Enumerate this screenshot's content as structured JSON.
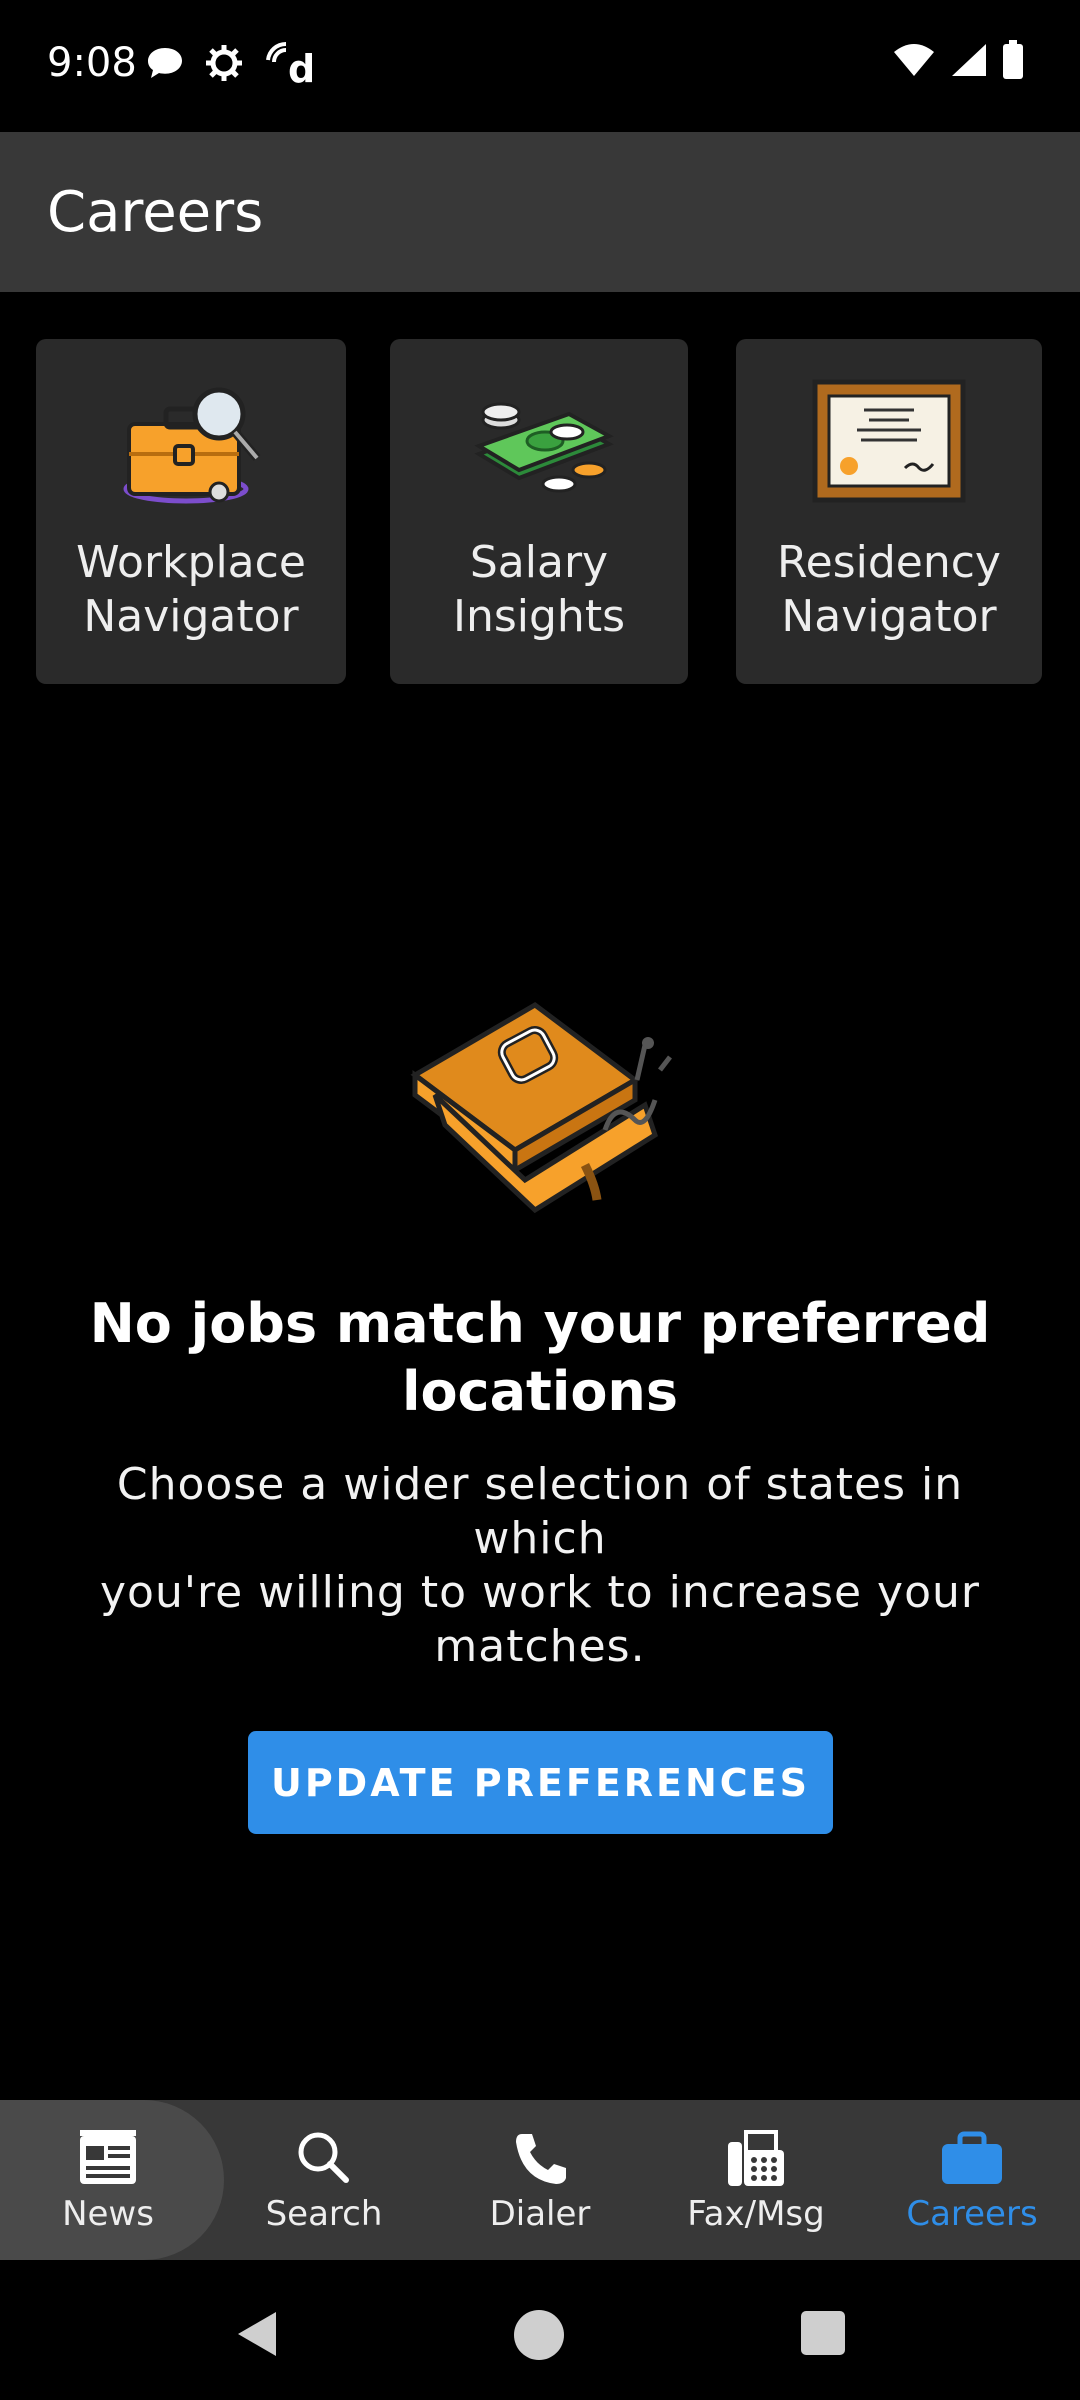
{
  "status_bar": {
    "time": "9:08",
    "left_icons": [
      "chat-bubble-icon",
      "gear-icon",
      "doximity-d-icon"
    ],
    "right_icons": [
      "wifi-icon",
      "signal-icon",
      "battery-icon"
    ]
  },
  "app_bar": {
    "title": "Careers"
  },
  "tiles": [
    {
      "label": "Workplace\nNavigator",
      "icon": "briefcase-magnifier-icon"
    },
    {
      "label": "Salary\nInsights",
      "icon": "cash-coins-icon"
    },
    {
      "label": "Residency\nNavigator",
      "icon": "framed-certificate-icon"
    }
  ],
  "empty_state": {
    "icon": "briefcase-illustration-icon",
    "title": "No jobs match your preferred\nlocations",
    "body": "Choose a wider selection of states in which\nyou're willing to work to increase your\nmatches.",
    "button_label": "UPDATE PREFERENCES"
  },
  "bottom_nav": {
    "items": [
      {
        "label": "News",
        "icon": "newspaper-icon"
      },
      {
        "label": "Search",
        "icon": "search-icon"
      },
      {
        "label": "Dialer",
        "icon": "phone-icon"
      },
      {
        "label": "Fax/Msg",
        "icon": "fax-icon"
      },
      {
        "label": "Careers",
        "icon": "briefcase-icon"
      }
    ],
    "active": "Careers"
  },
  "colors": {
    "accent": "#2f8ee8",
    "app_bar": "#383838",
    "tile": "#2a2a2a",
    "background": "#000000"
  }
}
